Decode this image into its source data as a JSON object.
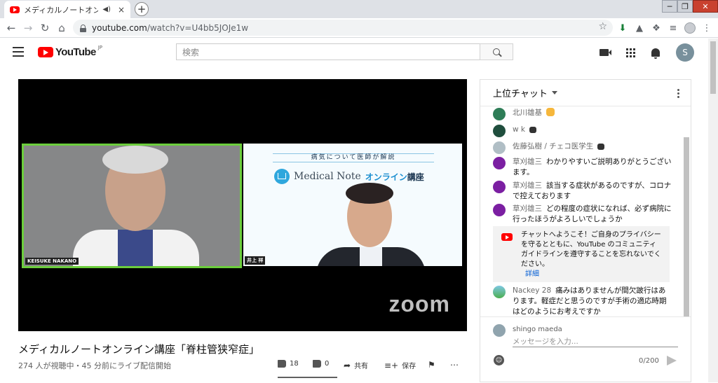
{
  "browser": {
    "tab_title": "メディカルノートオンライン",
    "tab_audio_icon": "speaker-icon",
    "tab_close": "×",
    "new_tab": "+",
    "url_host": "youtube.com",
    "url_path": "/watch?v=U4bb5JOJe1w"
  },
  "masthead": {
    "logo_text": "YouTube",
    "logo_region": "JP",
    "search_placeholder": "検索",
    "avatar_initial": "S"
  },
  "video": {
    "cam_left_name": "KEISUKE NAKANO",
    "cam_right_name": "井上 祥",
    "banner": "病気について医師が解説",
    "brand_en": "Medical Note",
    "brand_jp_a": "オンライン",
    "brand_jp_b": "講座",
    "watermark": "zoom",
    "title": "メディカルノートオンライン講座「脊柱管狭窄症」",
    "meta": "274 人が視聴中・45 分前にライブ配信開始",
    "likes": "18",
    "dislikes": "0",
    "share_label": "共有",
    "save_label": "保存",
    "like_ratio": 1.0
  },
  "chat": {
    "header": "上位チャット",
    "messages": [
      {
        "author": "北川雄基",
        "text": ""
      },
      {
        "author": "w k",
        "text": ""
      },
      {
        "author": "佐藤弘樹 / チェコ医学生",
        "text": ""
      },
      {
        "author": "草刈雄三",
        "text": "わかりやすいご説明ありがとうございます。"
      },
      {
        "author": "草刈雄三",
        "text": "該当する症状があるのですが、コロナで控えております"
      },
      {
        "author": "草刈雄三",
        "text": "どの程度の症状になれば、必ず病院に行ったほうがよろしいでしょうか"
      },
      {
        "author": "Nackey 28",
        "text": "痛みはありませんが間欠跛行はあります。軽症だと思うのですが手術の適応時期はどのようにお考えですか"
      }
    ],
    "system_text": "チャットへようこそ！ご自身のプライバシーを守るとともに、YouTube のコミュニティ ガイドラインを遵守することを忘れないでください。",
    "system_more": "詳細",
    "input_user": "shingo maeda",
    "input_placeholder": "メッセージを入力...",
    "char_count": "0/200"
  },
  "colors": {
    "youtube_red": "#ff0000",
    "cam_border": "#6cce3c",
    "link_blue": "#065fd4",
    "avatar_green": "#2e7d57",
    "avatar_purple": "#7b1fa2"
  }
}
